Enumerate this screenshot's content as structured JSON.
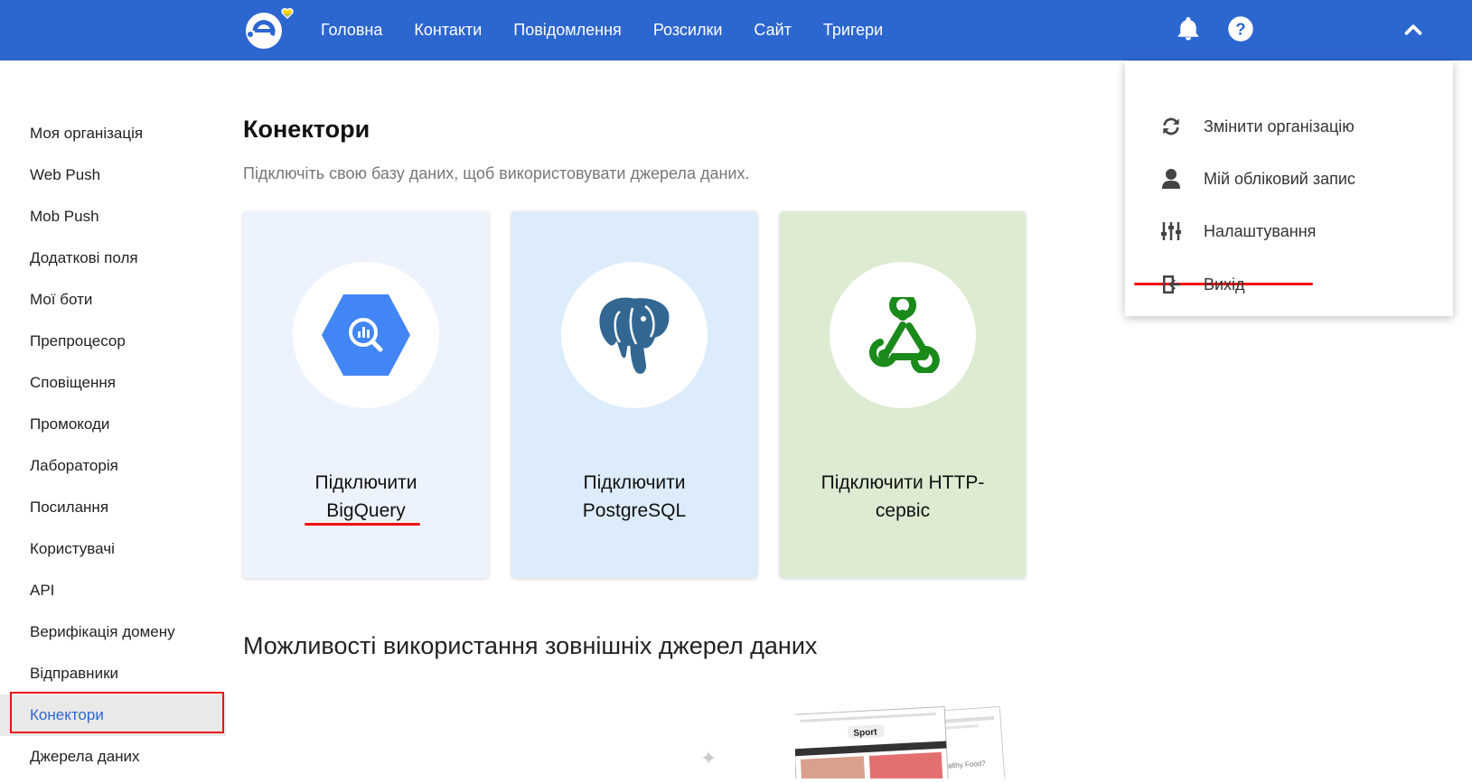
{
  "topbar": {
    "nav": [
      "Головна",
      "Контакти",
      "Повідомлення",
      "Розсилки",
      "Сайт",
      "Тригери"
    ]
  },
  "sidebar": {
    "items": [
      {
        "label": "Моя організація"
      },
      {
        "label": "Web Push"
      },
      {
        "label": "Mob Push"
      },
      {
        "label": "Додаткові поля"
      },
      {
        "label": "Мої боти"
      },
      {
        "label": "Препроцесор"
      },
      {
        "label": "Сповіщення"
      },
      {
        "label": "Промокоди"
      },
      {
        "label": "Лабораторія"
      },
      {
        "label": "Посилання"
      },
      {
        "label": "Користувачі"
      },
      {
        "label": "API"
      },
      {
        "label": "Верифікація домену"
      },
      {
        "label": "Відправники"
      },
      {
        "label": "Конектори",
        "active": true
      },
      {
        "label": "Джерела даних"
      }
    ]
  },
  "main": {
    "title": "Конектори",
    "subtitle": "Підключіть свою базу даних, щоб використовувати джерела даних.",
    "cards": [
      {
        "line1": "Підключити",
        "line2": "BigQuery",
        "icon": "bigquery-icon"
      },
      {
        "line1": "Підключити",
        "line2": "PostgreSQL",
        "icon": "postgresql-icon"
      },
      {
        "line1": "Підключити HTTP-",
        "line2": "сервіс",
        "icon": "webhook-icon"
      }
    ],
    "section_title": "Можливості використання зовнішніх джерел даних",
    "preview": {
      "brand": "Sport",
      "side_text": "Healthy Food?"
    }
  },
  "dropdown": {
    "items": [
      {
        "label": "Змінити організацію",
        "icon": "switch-org-icon"
      },
      {
        "label": "Мій обліковий запис",
        "icon": "user-icon"
      },
      {
        "label": "Налаштування",
        "icon": "settings-sliders-icon"
      },
      {
        "label": "Вихід",
        "icon": "logout-icon"
      }
    ]
  },
  "colors": {
    "brand": "#2c66cf",
    "highlight": "#ee1111",
    "bigquery": "#4285f4",
    "postgres": "#336791",
    "webhook": "#1a8a1a"
  }
}
